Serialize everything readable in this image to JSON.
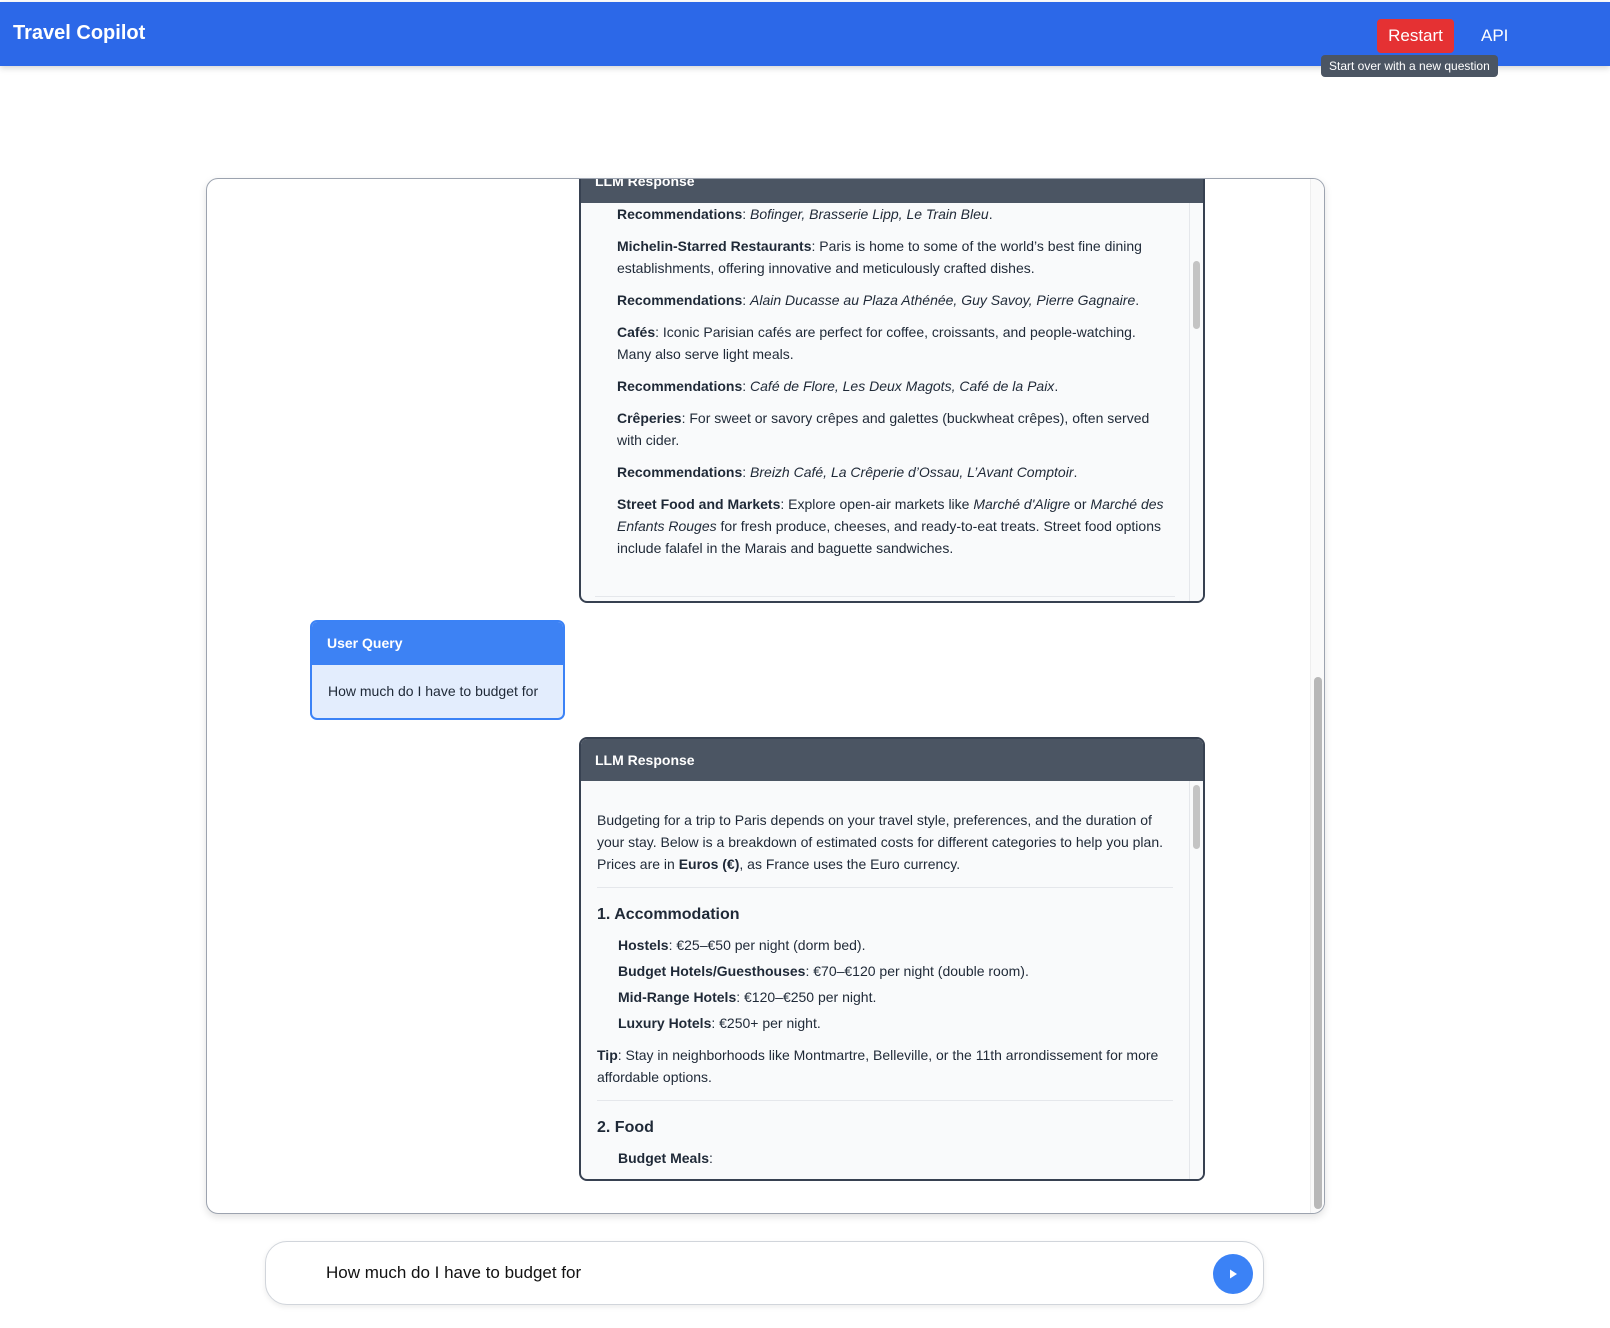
{
  "header": {
    "title": "Travel Copilot",
    "restart_label": "Restart",
    "api_label": "API",
    "restart_tooltip": "Start over with a new question"
  },
  "chat": {
    "previous_response": {
      "header": "LLM Response",
      "items": [
        {
          "label": "Recommendations",
          "text": ": ",
          "italic": "Bofinger, Brasserie Lipp, Le Train Bleu",
          "end": "."
        },
        {
          "label": "Michelin-Starred Restaurants",
          "text": ": Paris is home to some of the world’s best fine dining establishments, offering innovative and meticulously crafted dishes."
        },
        {
          "label": "Recommendations",
          "text": ": ",
          "italic": "Alain Ducasse au Plaza Athénée, Guy Savoy, Pierre Gagnaire",
          "end": "."
        },
        {
          "label": "Cafés",
          "text": ": Iconic Parisian cafés are perfect for coffee, croissants, and people-watching. Many also serve light meals."
        },
        {
          "label": "Recommendations",
          "text": ": ",
          "italic": "Café de Flore, Les Deux Magots, Café de la Paix",
          "end": "."
        },
        {
          "label": "Crêperies",
          "text": ": For sweet or savory crêpes and galettes (buckwheat crêpes), often served with cider."
        },
        {
          "label": "Recommendations",
          "text": ": ",
          "italic": "Breizh Café, La Crêperie d’Ossau, L’Avant Comptoir",
          "end": "."
        }
      ],
      "street_food": {
        "label": "Street Food and Markets",
        "pre": ": Explore open-air markets like ",
        "market1": "Marché d'Aligre",
        "mid": " or ",
        "market2": "Marché des Enfants Rouges",
        "post": " for fresh produce, cheeses, and ready-to-eat treats. Street food options include falafel in the Marais and baguette sandwiches."
      }
    },
    "user_query": {
      "header": "User Query",
      "text": "How much do I have to budget for"
    },
    "latest_response": {
      "header": "LLM Response",
      "intro_pre": "Budgeting for a trip to Paris depends on your travel style, preferences, and the duration of your stay. Below is a breakdown of estimated costs for different categories to help you plan. Prices are in ",
      "intro_bold": "Euros (€)",
      "intro_post": ", as France uses the Euro currency.",
      "section1_title": "1. Accommodation",
      "accommodation": [
        {
          "label": "Hostels",
          "text": ": €25–€50 per night (dorm bed)."
        },
        {
          "label": "Budget Hotels/Guesthouses",
          "text": ": €70–€120 per night (double room)."
        },
        {
          "label": "Mid-Range Hotels",
          "text": ": €120–€250 per night."
        },
        {
          "label": "Luxury Hotels",
          "text": ": €250+ per night."
        }
      ],
      "tip_label": "Tip",
      "tip_text": ": Stay in neighborhoods like Montmartre, Belleville, or the 11th arrondissement for more affordable options.",
      "section2_title": "2. Food",
      "budget_meals_label": "Budget Meals",
      "budget_meals_text": ":"
    }
  },
  "input": {
    "value": "How much do I have to budget for "
  },
  "icons": {
    "send": "send-icon"
  },
  "colors": {
    "header_bg": "#2c68e8",
    "restart_bg": "#e53133",
    "llm_header_bg": "#4b5563",
    "user_header_bg": "#3d82f4",
    "user_body_bg": "#e3edfd",
    "send_bg": "#3b82f6"
  }
}
